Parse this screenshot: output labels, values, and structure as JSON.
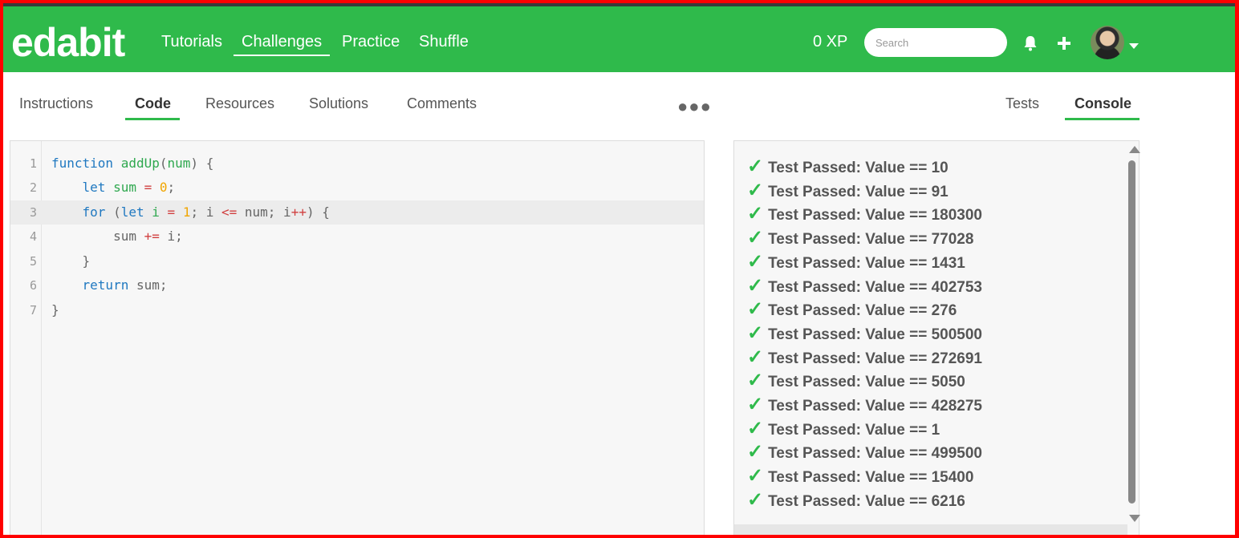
{
  "brand": {
    "logo": "edabit",
    "accent": "#2fba4b"
  },
  "nav": {
    "links": [
      "Tutorials",
      "Challenges",
      "Practice",
      "Shuffle"
    ],
    "active": "Challenges",
    "xp": "0 XP",
    "search_placeholder": "Search",
    "icons": [
      "bell-icon",
      "plus-icon",
      "avatar",
      "chevron-down-icon"
    ]
  },
  "left_tabs": [
    "Instructions",
    "Code",
    "Resources",
    "Solutions",
    "Comments"
  ],
  "left_active": "Code",
  "right_tabs": [
    "Tests",
    "Console"
  ],
  "right_active": "Console",
  "editor": {
    "line_numbers": [
      "1",
      "2",
      "3",
      "4",
      "5",
      "6",
      "7"
    ],
    "highlighted_line": 3,
    "lines": [
      "function addUp(num) {",
      "    let sum = 0;",
      "    for (let i = 1; i <= num; i++) {",
      "        sum += i;",
      "    }",
      "    return sum;",
      "}"
    ]
  },
  "console": {
    "check_glyph": "✓",
    "results": [
      "Test Passed: Value == 10",
      "Test Passed: Value == 91",
      "Test Passed: Value == 180300",
      "Test Passed: Value == 77028",
      "Test Passed: Value == 1431",
      "Test Passed: Value == 402753",
      "Test Passed: Value == 276",
      "Test Passed: Value == 500500",
      "Test Passed: Value == 272691",
      "Test Passed: Value == 5050",
      "Test Passed: Value == 428275",
      "Test Passed: Value == 1",
      "Test Passed: Value == 499500",
      "Test Passed: Value == 15400",
      "Test Passed: Value == 6216"
    ]
  }
}
